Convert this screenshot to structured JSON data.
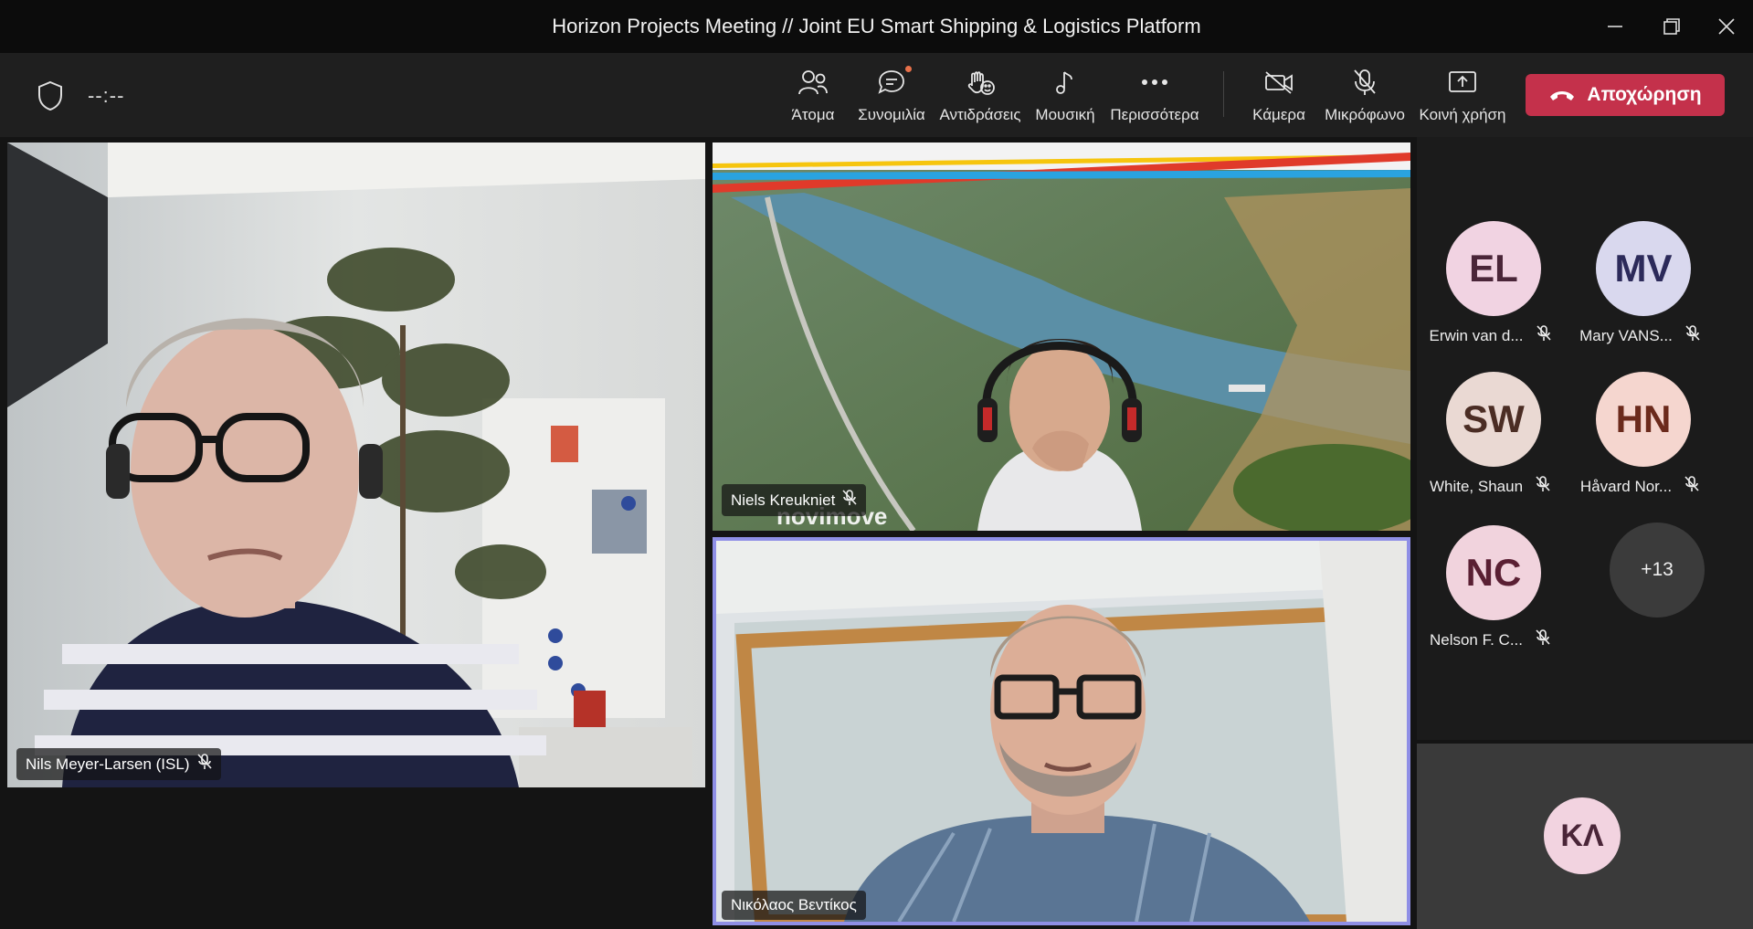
{
  "window": {
    "title": "Horizon Projects Meeting // Joint EU Smart Shipping & Logistics Platform"
  },
  "toolbar": {
    "timer": "--:--",
    "buttons": [
      {
        "label": "Άτομα",
        "icon": "people-icon"
      },
      {
        "label": "Συνομιλία",
        "icon": "chat-icon"
      },
      {
        "label": "Αντιδράσεις",
        "icon": "reactions-icon"
      },
      {
        "label": "Μουσική",
        "icon": "music-icon"
      },
      {
        "label": "Περισσότερα",
        "icon": "more-icon"
      },
      {
        "label": "Κάμερα",
        "icon": "camera-off-icon"
      },
      {
        "label": "Μικρόφωνο",
        "icon": "mic-off-icon"
      },
      {
        "label": "Κοινή χρήση",
        "icon": "share-icon"
      }
    ],
    "leave_label": "Αποχώρηση",
    "leave_color": "#c4314b"
  },
  "videos": [
    {
      "name": "Nils Meyer-Larsen (ISL)",
      "muted": true
    },
    {
      "name": "Niels Kreukniet",
      "muted": true,
      "slide_text": "novimove"
    },
    {
      "name": "Νικόλαος Βεντίκος",
      "muted": false,
      "active_speaker": true
    }
  ],
  "participants": [
    {
      "initials": "EL",
      "name": "Erwin van d...",
      "muted": true,
      "bg": "#f1d3e2",
      "fg": "#4a2538"
    },
    {
      "initials": "MV",
      "name": "Mary VANS...",
      "muted": true,
      "bg": "#d9d8ee",
      "fg": "#2c2a5a"
    },
    {
      "initials": "SW",
      "name": "White, Shaun",
      "muted": true,
      "bg": "#ead9d3",
      "fg": "#4b2d24"
    },
    {
      "initials": "HN",
      "name": "Håvard Nor...",
      "muted": true,
      "bg": "#f5d6cf",
      "fg": "#6b2a1c"
    },
    {
      "initials": "NC",
      "name": "Nelson F. C...",
      "muted": true,
      "bg": "#f1d3dd",
      "fg": "#5a1f33"
    }
  ],
  "more_participants": "+13",
  "self": {
    "initials": "ΚΛ"
  }
}
